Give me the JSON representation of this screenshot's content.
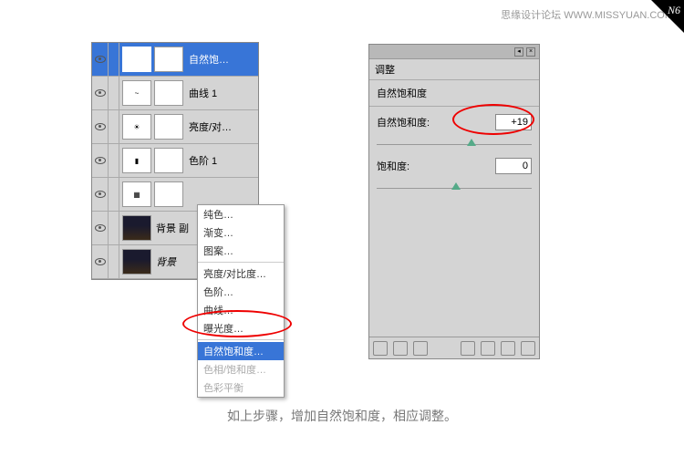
{
  "watermark": "思缘设计论坛  WWW.MISSYUAN.COM",
  "corner": "N6",
  "layers": [
    {
      "name": "自然饱…",
      "selected": true,
      "icon": "V"
    },
    {
      "name": "曲线 1",
      "icon": "~"
    },
    {
      "name": "亮度/对…",
      "icon": "☀"
    },
    {
      "name": "色阶 1",
      "icon": "▮"
    },
    {
      "name": "",
      "icon": "▦"
    },
    {
      "name": "背景 副",
      "city": true
    },
    {
      "name": "背景",
      "city": true,
      "italic": true
    }
  ],
  "menu": {
    "items": [
      {
        "label": "纯色…"
      },
      {
        "label": "渐变…"
      },
      {
        "label": "图案…"
      },
      {
        "sep": true
      },
      {
        "label": "亮度/对比度…"
      },
      {
        "label": "色阶…"
      },
      {
        "label": "曲线…"
      },
      {
        "label": "曝光度…"
      },
      {
        "sep": true
      },
      {
        "label": "自然饱和度…",
        "sel": true
      },
      {
        "label": "色相/饱和度…",
        "dis": true
      },
      {
        "label": "色彩平衡",
        "dis": true
      }
    ]
  },
  "adjust": {
    "tab": "调整",
    "title": "自然饱和度",
    "vibrance_label": "自然饱和度:",
    "vibrance_value": "+19",
    "saturation_label": "饱和度:",
    "saturation_value": "0"
  },
  "caption": "如上步骤，增加自然饱和度，相应调整。"
}
